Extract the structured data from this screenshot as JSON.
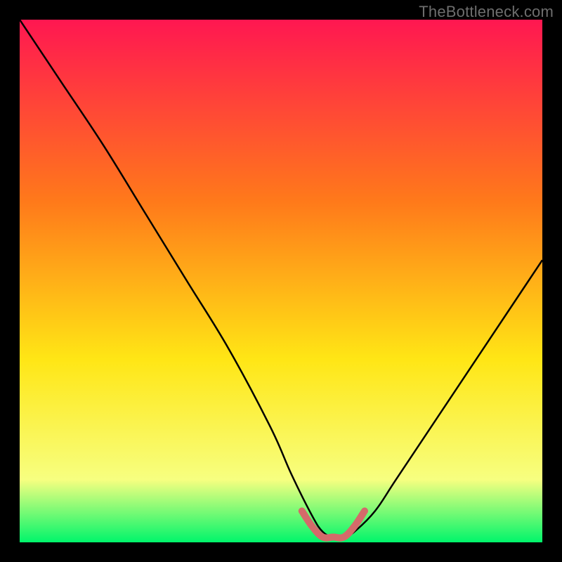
{
  "watermark": "TheBottleneck.com",
  "colors": {
    "background": "#000000",
    "gradient_top": "#ff1751",
    "gradient_mid1": "#ff7a1a",
    "gradient_mid2": "#ffe615",
    "gradient_mid3": "#f7ff80",
    "gradient_bottom": "#00f56b",
    "curve": "#000000",
    "valley_stroke": "#d46a6a",
    "watermark_color": "#6e6e6e"
  },
  "chart_data": {
    "type": "line",
    "title": "",
    "xlabel": "",
    "ylabel": "",
    "xlim": [
      0,
      100
    ],
    "ylim": [
      0,
      100
    ],
    "series": [
      {
        "name": "bottleneck-curve",
        "x": [
          0,
          8,
          16,
          24,
          32,
          40,
          48,
          52,
          56,
          58,
          60,
          62,
          64,
          68,
          72,
          80,
          88,
          96,
          100
        ],
        "y": [
          100,
          88,
          76,
          63,
          50,
          37,
          22,
          13,
          5,
          2,
          1,
          1,
          2,
          6,
          12,
          24,
          36,
          48,
          54
        ]
      }
    ],
    "valley_segment": {
      "x": [
        54,
        56,
        58,
        60,
        62,
        64,
        66
      ],
      "y": [
        6,
        3,
        1,
        1,
        1,
        3,
        6
      ]
    }
  }
}
